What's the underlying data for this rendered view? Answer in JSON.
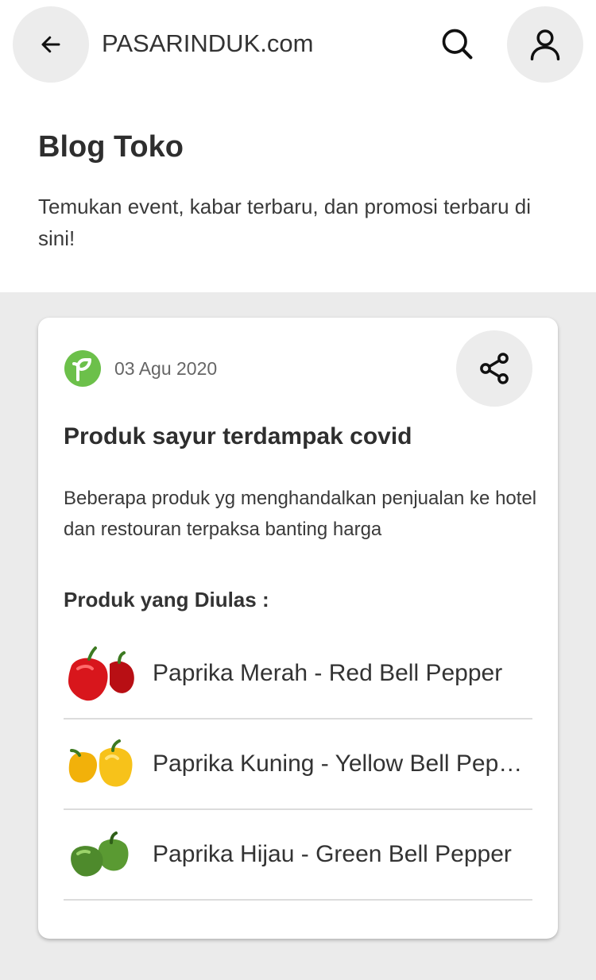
{
  "header": {
    "site_title": "PASARINDUK.com",
    "back_icon": "arrow-left-icon",
    "search_icon": "search-icon",
    "profile_icon": "user-icon"
  },
  "page": {
    "title": "Blog Toko",
    "subtitle": "Temukan event, kabar terbaru, dan promosi terbaru di sini!"
  },
  "post": {
    "date": "03 Agu 2020",
    "title": "Produk sayur terdampak covid",
    "excerpt": "Beberapa produk yg menghandalkan penjualan ke hotel dan restouran terpaksa banting harga",
    "reviewed_label": "Produk yang Diulas :",
    "products": [
      {
        "name": "Paprika Merah - Red Bell Pepper",
        "color": "#d8161c"
      },
      {
        "name": "Paprika Kuning - Yellow Bell Pepper",
        "color": "#f5b80c"
      },
      {
        "name": "Paprika Hijau - Green Bell Pepper",
        "color": "#4e8a2c"
      }
    ]
  },
  "colors": {
    "accent_green": "#6cc04a",
    "background_gray": "#ebebeb",
    "button_gray": "#ececec"
  }
}
